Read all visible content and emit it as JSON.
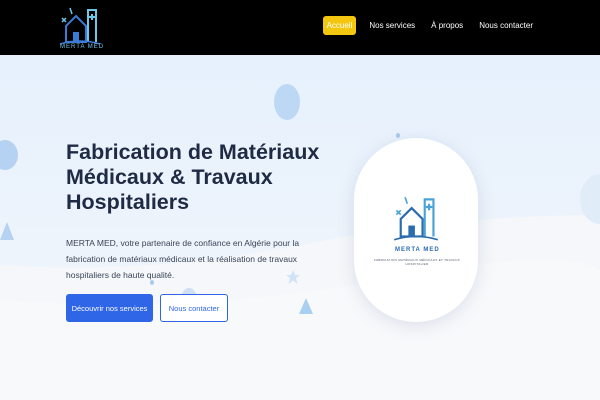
{
  "brand": {
    "name": "MERTA MED"
  },
  "nav": {
    "items": [
      {
        "label": "Accueil",
        "active": true
      },
      {
        "label": "Nos services",
        "active": false
      },
      {
        "label": "À propos",
        "active": false
      },
      {
        "label": "Nous contacter",
        "active": false
      }
    ]
  },
  "hero": {
    "title": "Fabrication de Matériaux Médicaux & Travaux Hospitaliers",
    "text": "MERTA MED, votre partenaire de confiance en Algérie pour la fabrication de matériaux médicaux et la réalisation de travaux hospitaliers de haute qualité.",
    "primary_button": "Découvrir nos services",
    "secondary_button": "Nous contacter"
  },
  "card": {
    "name": "MERTA MED",
    "tagline": "FABRICATION MATÉRIAUX MÉDICAUX ET TRAVAUX HOSPITALIER"
  },
  "colors": {
    "accent": "#f3c60f",
    "primary": "#2f66e8",
    "title": "#1f2a44",
    "navbar": "#000000"
  }
}
